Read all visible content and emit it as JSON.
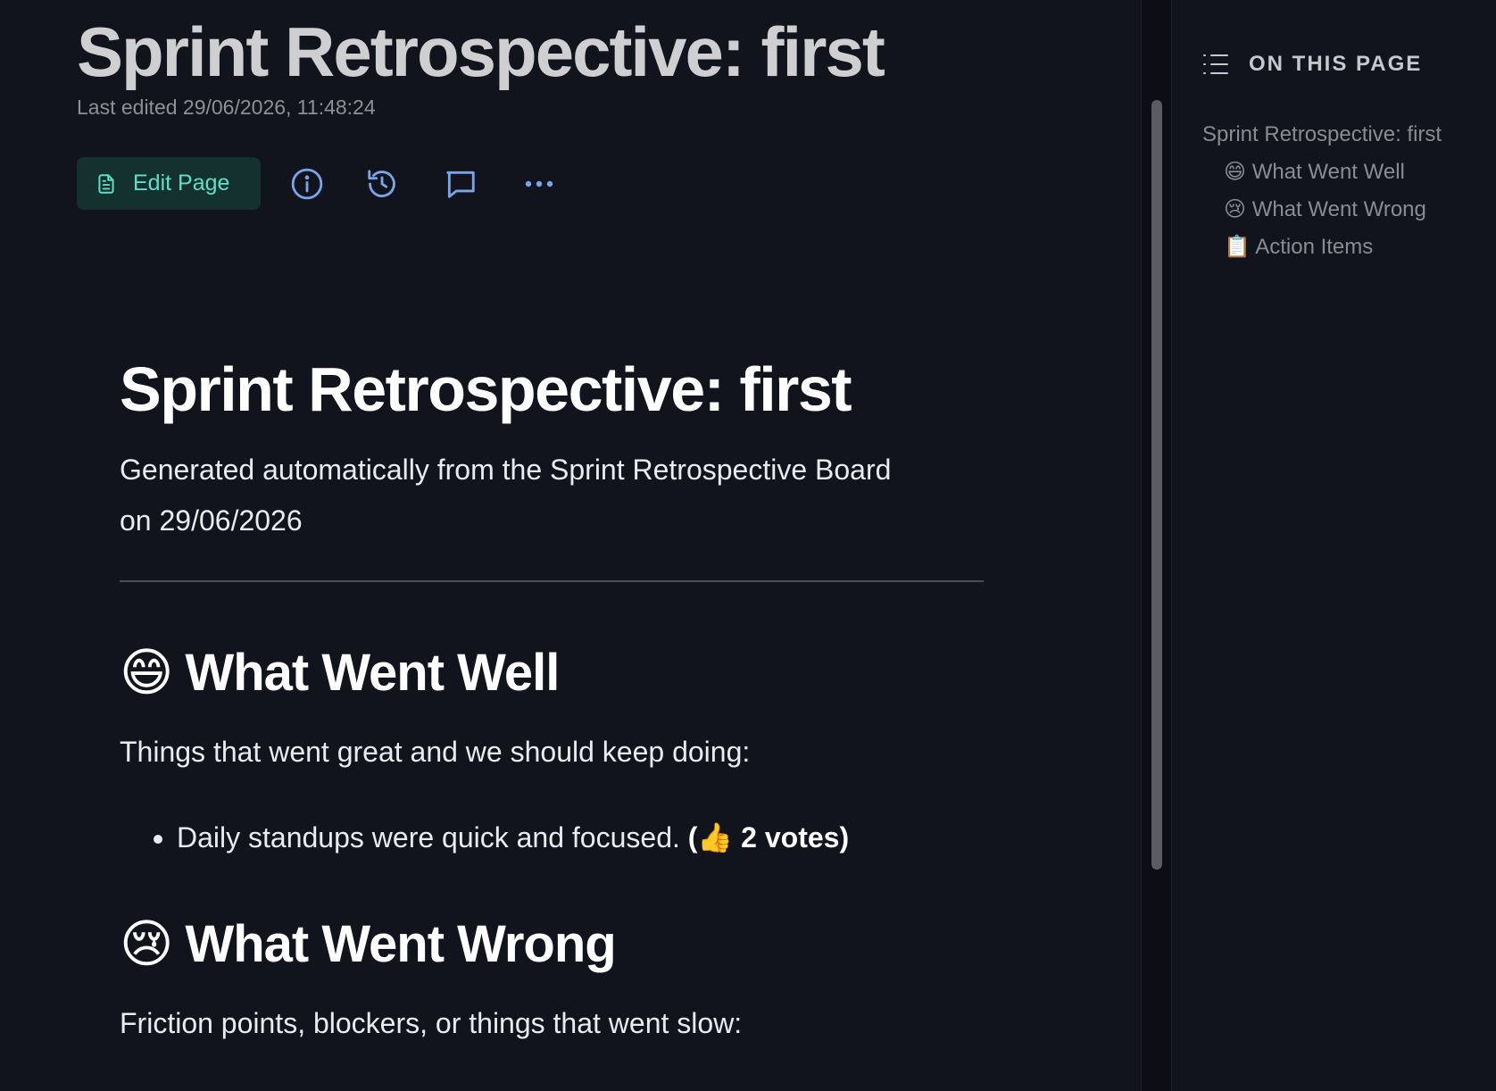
{
  "header": {
    "title": "Sprint Retrospective: first",
    "last_edited": "Last edited 29/06/2026, 11:48:24"
  },
  "toolbar": {
    "edit_label": "Edit Page",
    "edit_icon": "document-icon",
    "icons": [
      "info-icon",
      "history-icon",
      "comment-icon",
      "more-icon"
    ]
  },
  "content": {
    "title": "Sprint Retrospective: first",
    "subtitle": "Generated automatically from the Sprint Retrospective Board on 29/06/2026",
    "sections": [
      {
        "emoji": "😄",
        "heading": "What Went Well",
        "intro": "Things that went great and we should keep doing:",
        "items": [
          {
            "text": "Daily standups were quick and focused.",
            "votes": "(👍 2 votes)"
          }
        ]
      },
      {
        "emoji": "😢",
        "heading": "What Went Wrong",
        "intro": "Friction points, blockers, or things that went slow:"
      }
    ]
  },
  "toc": {
    "heading": "ON THIS PAGE",
    "items": [
      "Sprint Retrospective: first",
      "😄 What Went Well",
      "😢 What Went Wrong",
      "📋 Action Items"
    ]
  },
  "colors": {
    "background": "#11141c",
    "accent": "#5ee0c8",
    "icon": "#7aa4e8"
  }
}
